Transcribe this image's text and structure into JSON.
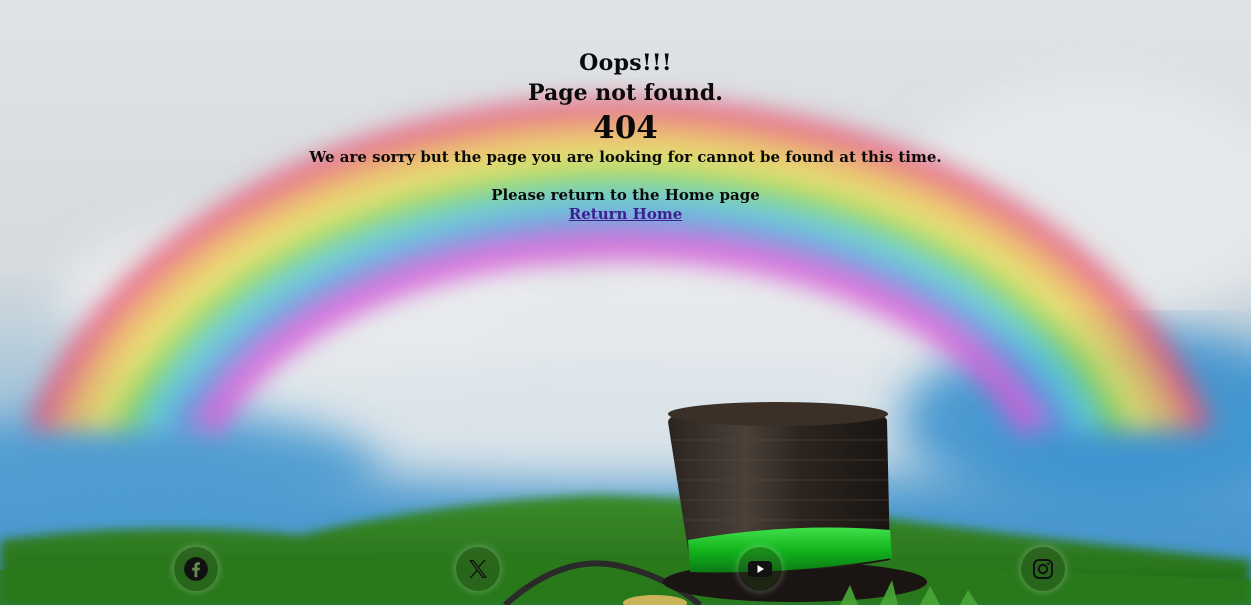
{
  "message": {
    "oops": "Oops!!!",
    "not_found": "Page not found.",
    "code": "404",
    "sorry": "We are sorry but the page you are looking for cannot be found at this time.",
    "please": "Please return to the Home page",
    "return_link": "Return Home"
  },
  "footer": {
    "social": [
      {
        "name": "facebook",
        "icon": "facebook-icon"
      },
      {
        "name": "x",
        "icon": "x-icon"
      },
      {
        "name": "youtube",
        "icon": "youtube-icon"
      },
      {
        "name": "instagram",
        "icon": "instagram-icon"
      }
    ]
  },
  "colors": {
    "link": "#3b1f8f",
    "text": "#0a0a0a"
  }
}
